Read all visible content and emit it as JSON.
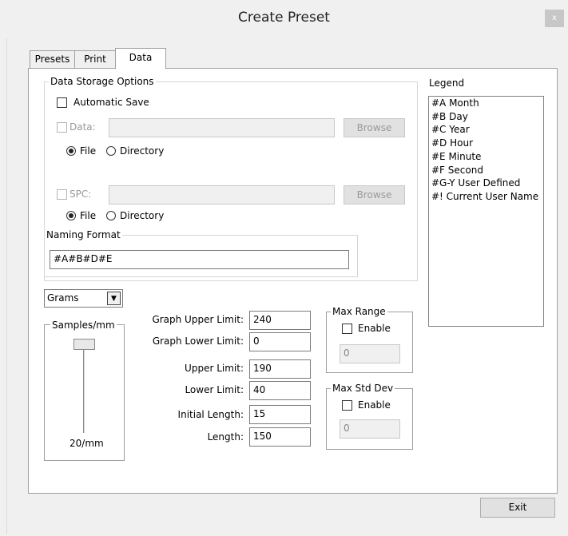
{
  "window": {
    "title": "Create Preset",
    "close_label": "x"
  },
  "tabs": [
    {
      "label": "Presets"
    },
    {
      "label": "Print"
    },
    {
      "label": "Data"
    }
  ],
  "data_storage": {
    "legend": "Data Storage Options",
    "auto_save_label": "Automatic Save",
    "data_label": "Data:",
    "data_path": "",
    "spc_label": "SPC:",
    "spc_path": "",
    "browse_label": "Browse",
    "file_label": "File",
    "directory_label": "Directory"
  },
  "naming": {
    "legend": "Naming Format",
    "value": "#A#B#D#E"
  },
  "legend_panel": {
    "title": "Legend",
    "items": [
      "#A Month",
      "#B Day",
      "#C Year",
      "#D Hour",
      "#E Minute",
      "#F Second",
      "#G-Y User Defined",
      "#! Current User Name"
    ]
  },
  "units": {
    "selected": "Grams"
  },
  "samples": {
    "legend": "Samples/mm",
    "value": "20/mm"
  },
  "limits": {
    "graph_upper_label": "Graph Upper Limit:",
    "graph_upper": "240",
    "graph_lower_label": "Graph Lower Limit:",
    "graph_lower": "0",
    "upper_label": "Upper Limit:",
    "upper": "190",
    "lower_label": "Lower Limit:",
    "lower": "40",
    "initial_length_label": "Initial Length:",
    "initial_length": "15",
    "length_label": "Length:",
    "length": "150"
  },
  "max_range": {
    "legend": "Max Range",
    "enable_label": "Enable",
    "value": "0"
  },
  "max_std_dev": {
    "legend": "Max Std Dev",
    "enable_label": "Enable",
    "value": "0"
  },
  "footer": {
    "exit_label": "Exit"
  }
}
